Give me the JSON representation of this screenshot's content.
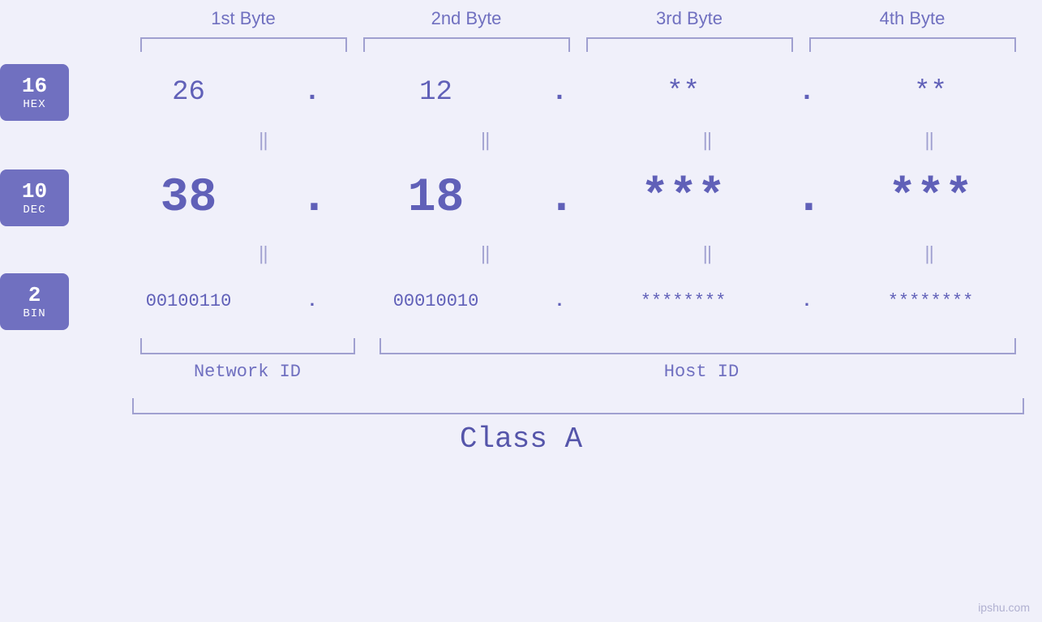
{
  "background_color": "#f0f0fa",
  "accent_color": "#7070c0",
  "text_color": "#6060b8",
  "muted_color": "#a0a0d0",
  "byte_headers": [
    "1st Byte",
    "2nd Byte",
    "3rd Byte",
    "4th Byte"
  ],
  "rows": {
    "hex": {
      "badge_number": "16",
      "badge_label": "HEX",
      "values": [
        "26",
        "12",
        "**",
        "**"
      ],
      "dots": [
        ".",
        ".",
        ".",
        ""
      ],
      "size": "medium"
    },
    "dec": {
      "badge_number": "10",
      "badge_label": "DEC",
      "values": [
        "38",
        "18",
        "***",
        "***"
      ],
      "dots": [
        ".",
        ".",
        ".",
        ""
      ],
      "size": "large"
    },
    "bin": {
      "badge_number": "2",
      "badge_label": "BIN",
      "values": [
        "00100110",
        "00010010",
        "********",
        "********"
      ],
      "dots": [
        ".",
        ".",
        ".",
        ""
      ],
      "size": "small"
    }
  },
  "separators": [
    "‖",
    "‖",
    "‖",
    "‖"
  ],
  "network_id_label": "Network ID",
  "host_id_label": "Host ID",
  "class_label": "Class A",
  "watermark": "ipshu.com"
}
